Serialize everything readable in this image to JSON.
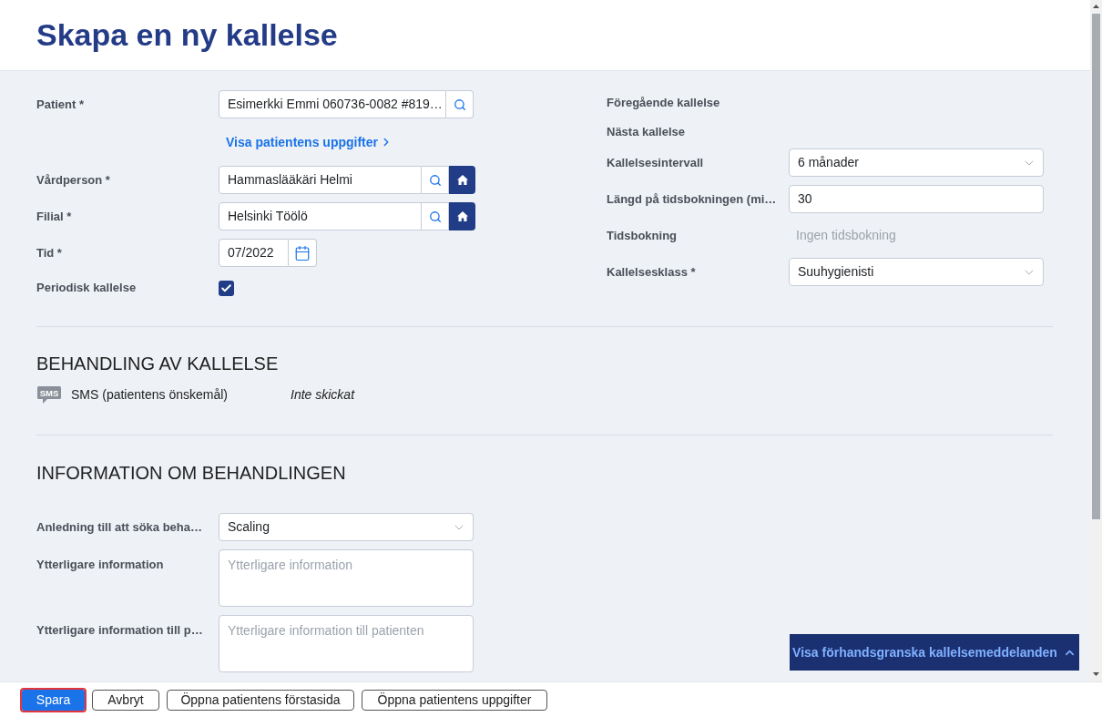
{
  "header": {
    "title": "Skapa en ny kallelse"
  },
  "left_fields": [
    {
      "kind": "lookup",
      "label": "Patient *",
      "value": "Esimerkki Emmi 060736-0082 #819…"
    },
    {
      "kind": "link",
      "label": "Visa patientens uppgifter"
    },
    {
      "kind": "lookup_home",
      "label": "Vårdperson *",
      "value": "Hammaslääkäri Helmi"
    },
    {
      "kind": "lookup_home",
      "label": "Filial *",
      "value": "Helsinki Töölö"
    },
    {
      "kind": "date",
      "label": "Tid *",
      "value": "07/2022"
    },
    {
      "kind": "checkbox",
      "label": "Periodisk kallelse",
      "checked": true
    }
  ],
  "right_fields": [
    {
      "kind": "text",
      "label": "Föregående kallelse"
    },
    {
      "kind": "text",
      "label": "Nästa kallelse"
    },
    {
      "kind": "select",
      "label": "Kallelsesintervall",
      "value": "6 månader"
    },
    {
      "kind": "input",
      "label": "Längd på tidsbokningen (mi…",
      "value": "30"
    },
    {
      "kind": "readout",
      "label": "Tidsbokning",
      "value": "Ingen tidsbokning"
    },
    {
      "kind": "select",
      "label": "Kallelsesklass *",
      "value": "Suuhygienisti"
    }
  ],
  "handling": {
    "title": "BEHANDLING AV KALLELSE",
    "channels": [
      {
        "icon_text": "SMS",
        "name": "SMS (patientens önskemål)",
        "status": "Inte skickat"
      }
    ]
  },
  "treatment": {
    "title": "INFORMATION OM BEHANDLINGEN",
    "fields": [
      {
        "kind": "select",
        "label": "Anledning till att söka beha…",
        "value": "Scaling"
      },
      {
        "kind": "textarea",
        "label": "Ytterligare information",
        "placeholder": "Ytterligare information"
      },
      {
        "kind": "textarea",
        "label": "Ytterligare information till p…",
        "placeholder": "Ytterligare information till patienten"
      }
    ]
  },
  "preview_button": {
    "label": "Visa förhandsgranska kallelsemeddelanden"
  },
  "footer_buttons": [
    {
      "label": "Spara",
      "kind": "primary",
      "focused": true
    },
    {
      "label": "Avbryt",
      "kind": "secondary",
      "focused": false
    },
    {
      "label": "Öppna patientens förstasida",
      "kind": "secondary",
      "focused": false
    },
    {
      "label": "Öppna patientens uppgifter",
      "kind": "secondary",
      "focused": false
    }
  ]
}
